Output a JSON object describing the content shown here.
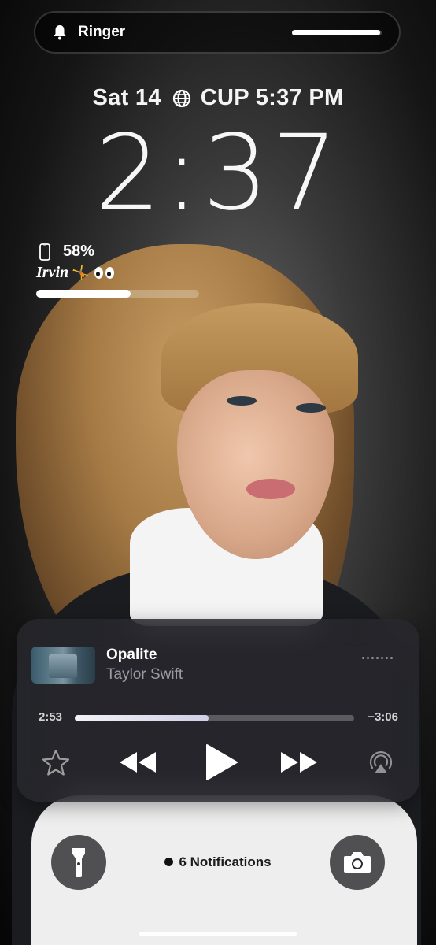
{
  "ringer": {
    "label": "Ringer",
    "level": 0.98,
    "icon": "bell-icon"
  },
  "date": {
    "day": "Sat 14",
    "world_clock_label": "CUP 5:37 PM",
    "icon": "globe-icon"
  },
  "clock": {
    "time": "2:37"
  },
  "battery_widget": {
    "percent_label": "58%",
    "percent": 0.58,
    "name": "Irvin",
    "emoji": "🤸",
    "icon": "iphone-icon"
  },
  "now_playing": {
    "title": "Opalite",
    "artist": "Taylor Swift",
    "elapsed": "2:53",
    "remaining": "−3:06",
    "progress": 0.48
  },
  "notifications": {
    "label": "6 Notifications"
  },
  "colors": {
    "accent": "#ffffff",
    "player_bg": "#28282e"
  }
}
